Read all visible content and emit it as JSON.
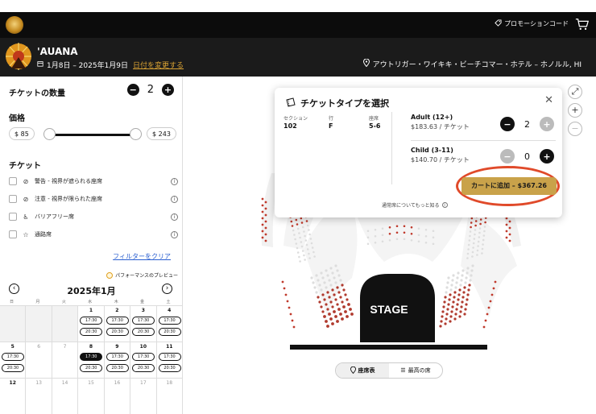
{
  "header": {
    "promo_label": "プロモーションコード",
    "cart_icon": "cart-icon",
    "logo_icon": "brand-logo"
  },
  "event": {
    "title": "'AUANA",
    "dates": "1月8日 – 2025年1月9日",
    "change_date_link": "日付を変更する",
    "venue": "アウトリガー・ワイキキ・ビーチコマー・ホテル – ホノルル, HI"
  },
  "sidebar": {
    "qty_label": "チケットの数量",
    "qty_value": "2",
    "price_label": "価格",
    "price_min": "$ 85",
    "price_max": "$ 243",
    "tickets_label": "チケット",
    "filters": [
      {
        "label": "警告 - 視界が遮られる座席",
        "icon": "eye-off-icon"
      },
      {
        "label": "注意 - 視界が限られた座席",
        "icon": "eye-off-icon"
      },
      {
        "label": "バリアフリー席",
        "icon": "wheelchair-icon"
      },
      {
        "label": "通路席",
        "icon": "star-icon"
      }
    ],
    "clear_filters": "フィルターをクリア",
    "preview_label": "パフォーマンスのプレビュー"
  },
  "calendar": {
    "month": "2025年1月",
    "weekdays": [
      "日",
      "月",
      "火",
      "水",
      "木",
      "金",
      "土"
    ],
    "weeks": [
      [
        {
          "num": "",
          "empty": true,
          "times": []
        },
        {
          "num": "",
          "empty": true,
          "times": []
        },
        {
          "num": "",
          "empty": true,
          "times": []
        },
        {
          "num": "1",
          "times": [
            "17:30",
            "20:30"
          ]
        },
        {
          "num": "2",
          "times": [
            "17:30",
            "20:30"
          ]
        },
        {
          "num": "3",
          "times": [
            "17:30",
            "20:30"
          ]
        },
        {
          "num": "4",
          "times": [
            "17:30",
            "20:30"
          ]
        }
      ],
      [
        {
          "num": "5",
          "times": [
            "17:30",
            "20:30"
          ]
        },
        {
          "num": "6",
          "past": true,
          "times": []
        },
        {
          "num": "7",
          "past": true,
          "times": []
        },
        {
          "num": "8",
          "times": [
            "17:30",
            "20:30"
          ],
          "selected": 0
        },
        {
          "num": "9",
          "times": [
            "17:30",
            "20:30"
          ]
        },
        {
          "num": "10",
          "times": [
            "17:30",
            "20:30"
          ]
        },
        {
          "num": "11",
          "times": [
            "17:30",
            "20:30"
          ]
        }
      ],
      [
        {
          "num": "12",
          "times": []
        },
        {
          "num": "13",
          "past": true,
          "times": []
        },
        {
          "num": "14",
          "past": true,
          "times": []
        },
        {
          "num": "15",
          "past": true,
          "times": []
        },
        {
          "num": "16",
          "past": true,
          "times": []
        },
        {
          "num": "17",
          "past": true,
          "times": []
        },
        {
          "num": "18",
          "past": true,
          "times": []
        }
      ]
    ]
  },
  "popup": {
    "title": "チケットタイプを選択",
    "section_label": "セクション",
    "section_value": "102",
    "row_label": "行",
    "row_value": "F",
    "seat_label": "座席",
    "seat_value": "5-6",
    "ticket_types": [
      {
        "name": "Adult (12+)",
        "price": "$183.63 / チケット",
        "qty": "2"
      },
      {
        "name": "Child (3-11)",
        "price": "$140.70 / チケット",
        "qty": "0"
      }
    ],
    "add_to_cart": "カートに追加 – $367.26",
    "general_note": "通常席についてもっと知る"
  },
  "map": {
    "stage_label": "STAGE",
    "toggle_seatmap": "座席表",
    "toggle_best": "最高の席"
  }
}
